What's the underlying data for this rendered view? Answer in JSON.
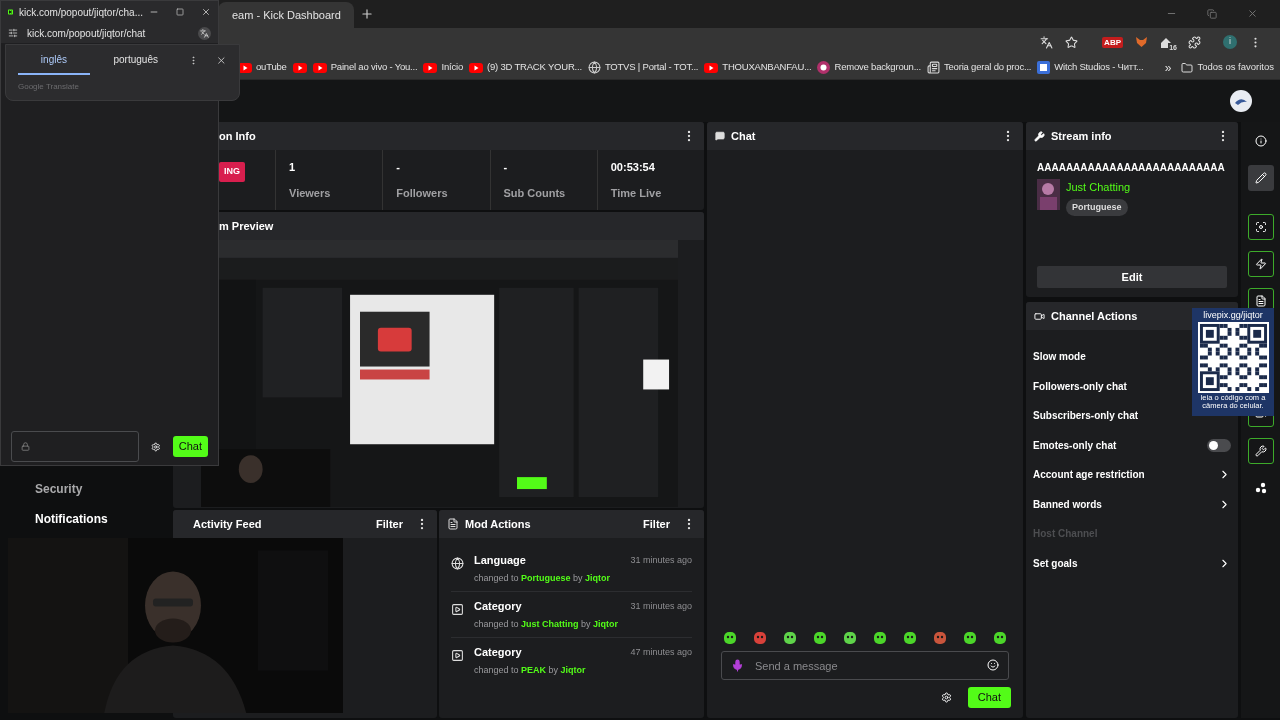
{
  "browser": {
    "tabs": [
      {
        "title": "eam - Kick Dashboard",
        "selected": true
      }
    ],
    "adblock_label": "ABP",
    "extension_badge": "16",
    "profile_initial": "i",
    "bookmarks": [
      {
        "kind": "youtube",
        "label": "ouTube"
      },
      {
        "kind": "youtube"
      },
      {
        "kind": "youtube",
        "label": "Painel ao vivo - You..."
      },
      {
        "kind": "youtube",
        "label": "Início"
      },
      {
        "kind": "youtube",
        "label": "(9) 3D TRACK YOUR..."
      },
      {
        "kind": "globe",
        "label": "TOTVS | Portal - TOT..."
      },
      {
        "kind": "youtube",
        "label": "THOUXANBANFAU..."
      },
      {
        "kind": "circle",
        "label": "Remove backgroun..."
      },
      {
        "kind": "news",
        "label": "Teoria geral do proc..."
      },
      {
        "kind": "site",
        "label": "Witch Studios - Читт..."
      }
    ],
    "bookmarks_overflow": "»",
    "all_bookmarks": "Todos os favoritos"
  },
  "popout": {
    "title": "kick.com/popout/jiqtor/cha...",
    "url": "kick.com/popout/jiqtor/chat",
    "translate": {
      "languages": [
        {
          "label": "inglês",
          "selected": true
        },
        {
          "label": "português",
          "selected": false
        }
      ],
      "provider": "Google Translate"
    },
    "send_button": "Chat"
  },
  "sidebar": {
    "items": [
      {
        "label": "Security",
        "selected": false
      },
      {
        "label": "Notifications",
        "selected": true
      }
    ]
  },
  "session_info": {
    "title": "on Info",
    "status_badge": "ING",
    "stats": [
      {
        "value": "1",
        "label": "Viewers"
      },
      {
        "value": "-",
        "label": "Followers"
      },
      {
        "value": "-",
        "label": "Sub Counts"
      },
      {
        "value": "00:53:54",
        "label": "Time Live"
      }
    ]
  },
  "stream_preview": {
    "title": "m Preview",
    "kind": "picture"
  },
  "activity_feed": {
    "title": "Activity Feed",
    "filter": "Filter"
  },
  "mod_actions": {
    "title": "Mod Actions",
    "filter": "Filter",
    "items": [
      {
        "kind": "language",
        "title": "Language",
        "detail": "changed to **Portuguese** by **Jiqtor**",
        "time": "31 minutes ago"
      },
      {
        "kind": "category",
        "title": "Category",
        "detail": "changed to **Just Chatting** by **Jiqtor**",
        "time": "31 minutes ago"
      },
      {
        "kind": "category",
        "title": "Category",
        "detail": "changed to **PEAK** by **Jiqtor**",
        "time": "47 minutes ago"
      }
    ]
  },
  "chat": {
    "title": "Chat",
    "emotes": [
      {
        "color": "#4cd62a"
      },
      {
        "color": "#d8413a"
      },
      {
        "color": "#5fd34a"
      },
      {
        "color": "#4cd62a"
      },
      {
        "color": "#5fd34a"
      },
      {
        "color": "#4cd62a"
      },
      {
        "color": "#4cd62a"
      },
      {
        "color": "#c9553c"
      },
      {
        "color": "#4cd62a"
      },
      {
        "color": "#4cd62a"
      }
    ],
    "placeholder": "Send a message",
    "send_button": "Chat"
  },
  "stream_info": {
    "title": "Stream info",
    "stream_title": "AAAAAAAAAAAAAAAAAAAAAAAAAA",
    "category": "Just Chatting",
    "language": "Portuguese",
    "edit_button": "Edit"
  },
  "channel_actions": {
    "title": "Channel Actions",
    "items": [
      {
        "kind": "plain",
        "label": "Slow mode"
      },
      {
        "kind": "plain",
        "label": "Followers-only chat"
      },
      {
        "kind": "plain",
        "label": "Subscribers-only chat"
      },
      {
        "kind": "toggle",
        "label": "Emotes-only chat",
        "on": false
      },
      {
        "kind": "link",
        "label": "Account age restriction"
      },
      {
        "kind": "link",
        "label": "Banned words"
      },
      {
        "kind": "disabled",
        "label": "Host Channel"
      },
      {
        "kind": "link",
        "label": "Set goals"
      }
    ]
  },
  "rail": [
    {
      "kind": "info",
      "selected": false
    },
    {
      "kind": "pencil",
      "selected": true
    },
    {
      "kind": "focus",
      "selected": false
    },
    {
      "kind": "zap",
      "selected": false
    },
    {
      "kind": "document",
      "selected": false
    },
    {
      "kind": "video",
      "selected": false
    },
    {
      "kind": "wrench",
      "selected": false
    },
    {
      "kind": "dots",
      "selected": false
    }
  ],
  "qr_overlay": {
    "url": "livepix.gg/jiqtor",
    "caption": "leia o código com a câmera do celular."
  }
}
